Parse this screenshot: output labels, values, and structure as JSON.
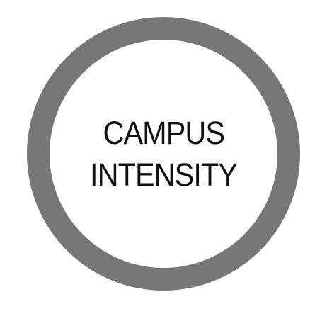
{
  "badge": {
    "line1": "CAMPUS",
    "line2": "INTENSITY",
    "ring_color": "#777777",
    "fill_color": "#ffffff",
    "text_color": "#111111"
  }
}
